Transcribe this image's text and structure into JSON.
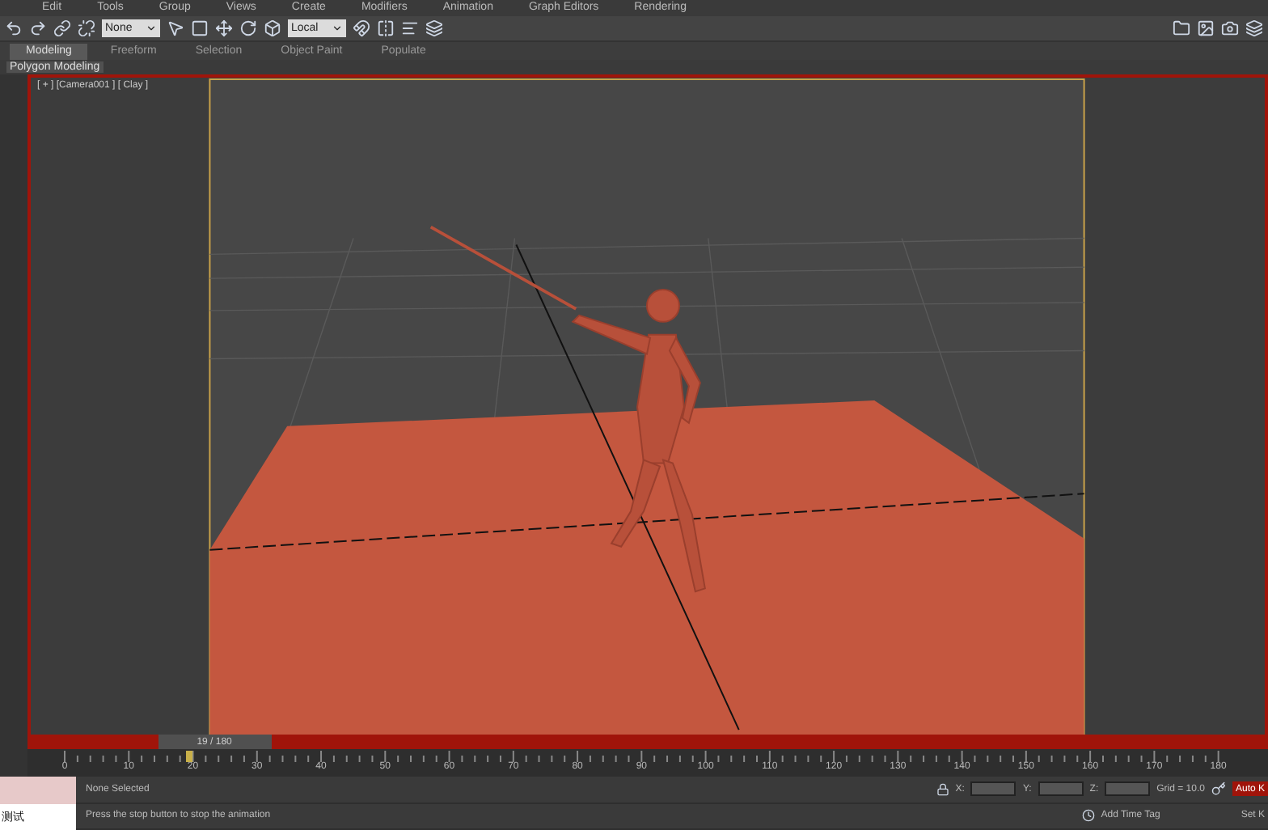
{
  "menu_bar": [
    "Edit",
    "Tools",
    "Group",
    "Views",
    "Create",
    "Modifiers",
    "Animation",
    "Graph Editors",
    "Rendering"
  ],
  "toolbar": {
    "selection_filter": "None",
    "reference_coordinate": "Local"
  },
  "ribbon_tabs": [
    {
      "label": "Modeling",
      "selected": true
    },
    {
      "label": "Freeform",
      "selected": false
    },
    {
      "label": "Selection",
      "selected": false
    },
    {
      "label": "Object Paint",
      "selected": false
    },
    {
      "label": "Populate",
      "selected": false
    }
  ],
  "ribbon_panel": "Polygon Modeling",
  "viewport": {
    "label": "[ + ] [Camera001 ] [ Clay ]"
  },
  "time_slider": {
    "frame": "19 / 180",
    "level": 0.105
  },
  "timeline": {
    "ticks": [
      "0",
      "10",
      "20",
      "30",
      "40",
      "50",
      "60",
      "70",
      "80",
      "90",
      "100",
      "110",
      "120",
      "130",
      "140",
      "150",
      "160",
      "170",
      "180"
    ],
    "level": 0.105
  },
  "status": {
    "script_output": "测试",
    "selection": "None Selected",
    "prompt": "Press the stop button to stop the animation",
    "x_label": "X:",
    "y_label": "Y:",
    "z_label": "Z:",
    "grid": "Grid = 10.0",
    "add_time_tag": "Add Time Tag",
    "auto_key": "Auto K",
    "set_key": "Set K"
  }
}
